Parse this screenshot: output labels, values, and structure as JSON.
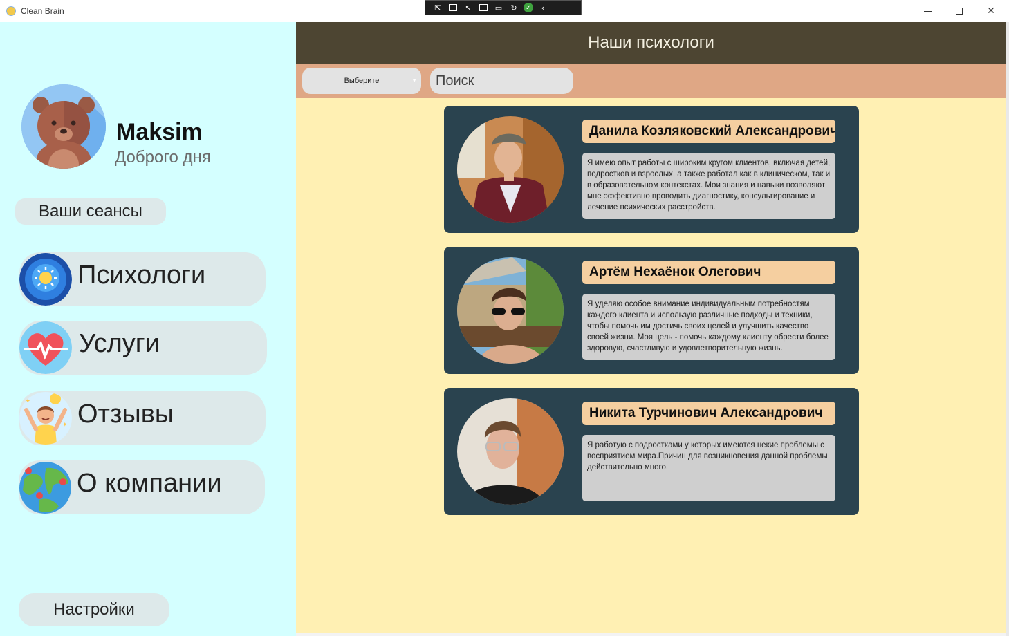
{
  "window": {
    "title": "Clean Brain"
  },
  "sidebar": {
    "user_name": "Maksim",
    "greeting": "Доброго дня",
    "sessions_label": "Ваши сеансы",
    "nav": [
      {
        "label": "Психологи",
        "icon": "brain-icon"
      },
      {
        "label": "Услуги",
        "icon": "heart-pulse-icon"
      },
      {
        "label": "Отзывы",
        "icon": "happy-person-icon"
      },
      {
        "label": "О компании",
        "icon": "globe-pins-icon"
      }
    ],
    "settings_label": "Настройки"
  },
  "main": {
    "title": "Наши психологи",
    "filter": {
      "select_value": "Выберите",
      "search_placeholder": "Поиск"
    },
    "psychologists": [
      {
        "name": "Данила Козляковский Александрович",
        "description": "Я имею опыт работы с широким кругом клиентов, включая детей, подростков и взрослых, а также работал как в клиническом, так и в образовательном контекстах. Мои знания и навыки позволяют мне эффективно проводить диагностику, консультирование и лечение психических расстройств."
      },
      {
        "name": "Артём Нехаёнок Олегович",
        "description": "Я уделяю особое внимание индивидуальным потребностям каждого клиента и использую различные подходы и техники, чтобы помочь им достичь своих целей и улучшить качество своей жизни. Моя цель - помочь каждому клиенту обрести более здоровую, счастливую и удовлетворительную жизнь."
      },
      {
        "name": "Никита Турчинович Александрович",
        "description": "Я работую с подростками у которых имеются некие проблемы с восприятием мира.Причин для возникновения данной проблемы действительно много."
      }
    ]
  },
  "colors": {
    "sidebar_bg": "#d4ffff",
    "header_bg": "#4d4532",
    "filter_bg": "#dfa785",
    "content_bg": "#fff0b3",
    "card_bg": "#2a434f",
    "name_bg": "#f5cfa0"
  }
}
